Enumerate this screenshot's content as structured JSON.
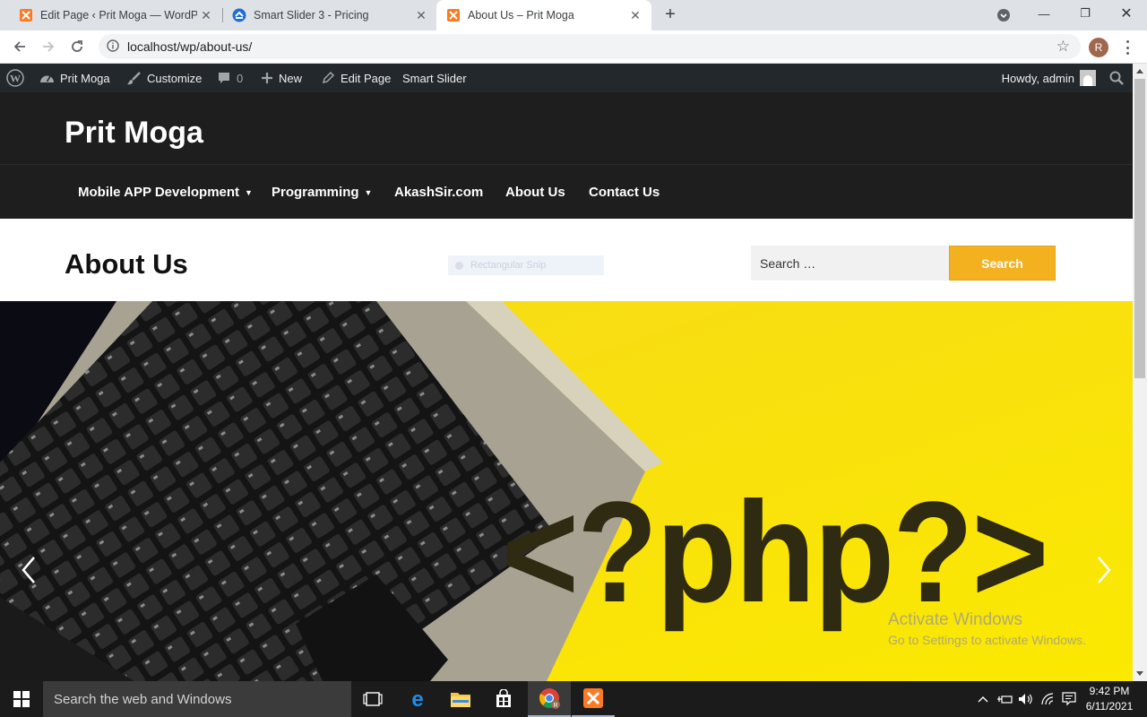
{
  "browser": {
    "tabs": [
      {
        "title": "Edit Page ‹ Prit Moga — WordPress",
        "favicon": "xampp-icon",
        "active": false
      },
      {
        "title": "Smart Slider 3 - Pricing",
        "favicon": "smart-slider-icon",
        "active": false
      },
      {
        "title": "About Us – Prit Moga",
        "favicon": "xampp-icon",
        "active": true
      }
    ],
    "url": "localhost/wp/about-us/",
    "profile_initial": "R"
  },
  "adminbar": {
    "site_name": "Prit Moga",
    "customize": "Customize",
    "comments_count": "0",
    "new": "New",
    "edit_page": "Edit Page",
    "smart_slider": "Smart Slider",
    "howdy": "Howdy, admin"
  },
  "site": {
    "title": "Prit Moga",
    "nav": [
      {
        "label": "Mobile APP Development",
        "has_dropdown": true
      },
      {
        "label": "Programming",
        "has_dropdown": true
      },
      {
        "label": "AkashSir.com",
        "has_dropdown": false
      },
      {
        "label": "About Us",
        "has_dropdown": false
      },
      {
        "label": "Contact Us",
        "has_dropdown": false
      }
    ]
  },
  "page": {
    "title": "About Us",
    "snip_overlay": "Rectangular Snip",
    "search_placeholder": "Search …",
    "search_button": "Search"
  },
  "slider": {
    "slide_text": "<?php?>",
    "watermark_line1": "Activate Windows",
    "watermark_line2": "Go to Settings to activate Windows."
  },
  "taskbar": {
    "search_placeholder": "Search the web and Windows",
    "time": "9:42 PM",
    "date": "6/11/2021"
  },
  "colors": {
    "admin_bar": "#23282d",
    "site_header": "#1e1e1e",
    "search_button": "#f3b120",
    "slide_yellow": "#f8e20f"
  }
}
